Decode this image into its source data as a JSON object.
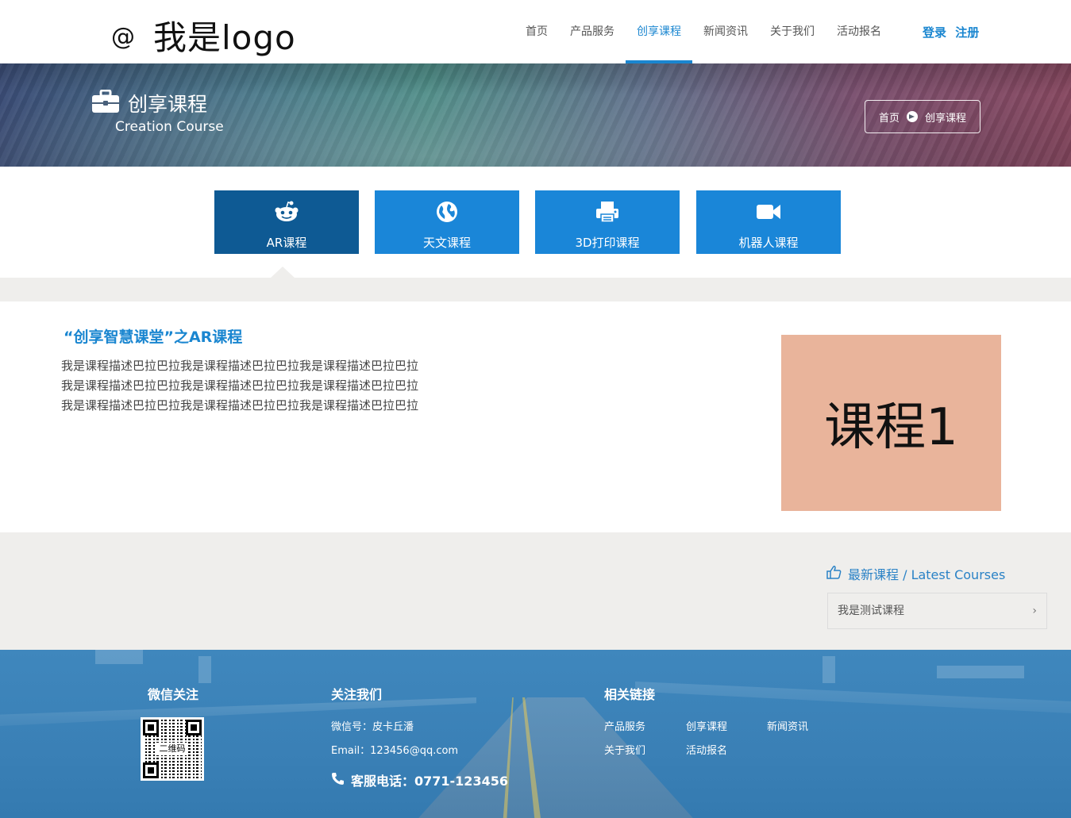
{
  "header": {
    "logo": {
      "symbol": "@",
      "text": "我是logo"
    },
    "nav": [
      "首页",
      "产品服务",
      "创享课程",
      "新闻资讯",
      "关于我们",
      "活动报名"
    ],
    "active_nav": "创享课程",
    "login": "登录",
    "register": "注册",
    "accent_color": "#1a86d0"
  },
  "banner": {
    "icon": "briefcase-icon",
    "title": "创享课程",
    "subtitle": "Creation Course",
    "breadcrumb": {
      "home": "首页",
      "current": "创享课程"
    }
  },
  "tabs": [
    {
      "label": "AR课程",
      "icon": "reddit-alien-icon",
      "active": true
    },
    {
      "label": "天文课程",
      "icon": "globe-icon",
      "active": false
    },
    {
      "label": "3D打印课程",
      "icon": "printer-icon",
      "active": false
    },
    {
      "label": "机器人课程",
      "icon": "video-camera-icon",
      "active": false
    }
  ],
  "course": {
    "title": "“创享智慧课堂”之AR课程",
    "description": [
      "我是课程描述巴拉巴拉我是课程描述巴拉巴拉我是课程描述巴拉巴拉",
      "我是课程描述巴拉巴拉我是课程描述巴拉巴拉我是课程描述巴拉巴拉",
      "我是课程描述巴拉巴拉我是课程描述巴拉巴拉我是课程描述巴拉巴拉"
    ],
    "image_text": "课程1"
  },
  "latest": {
    "icon": "thumbs-up-icon",
    "title": "最新课程 / Latest Courses",
    "items": [
      "我是测试课程"
    ]
  },
  "footer": {
    "wechat": {
      "title": "微信关注",
      "qr_label": "二维码"
    },
    "follow": {
      "title": "关注我们",
      "wechat_id": "微信号：皮卡丘潘",
      "email": "Email：123456@qq.com",
      "phone": "客服电话：0771-123456"
    },
    "links": {
      "title": "相关链接",
      "items": [
        "产品服务",
        "创享课程",
        "新闻资讯",
        "关于我们",
        "活动报名"
      ]
    }
  }
}
